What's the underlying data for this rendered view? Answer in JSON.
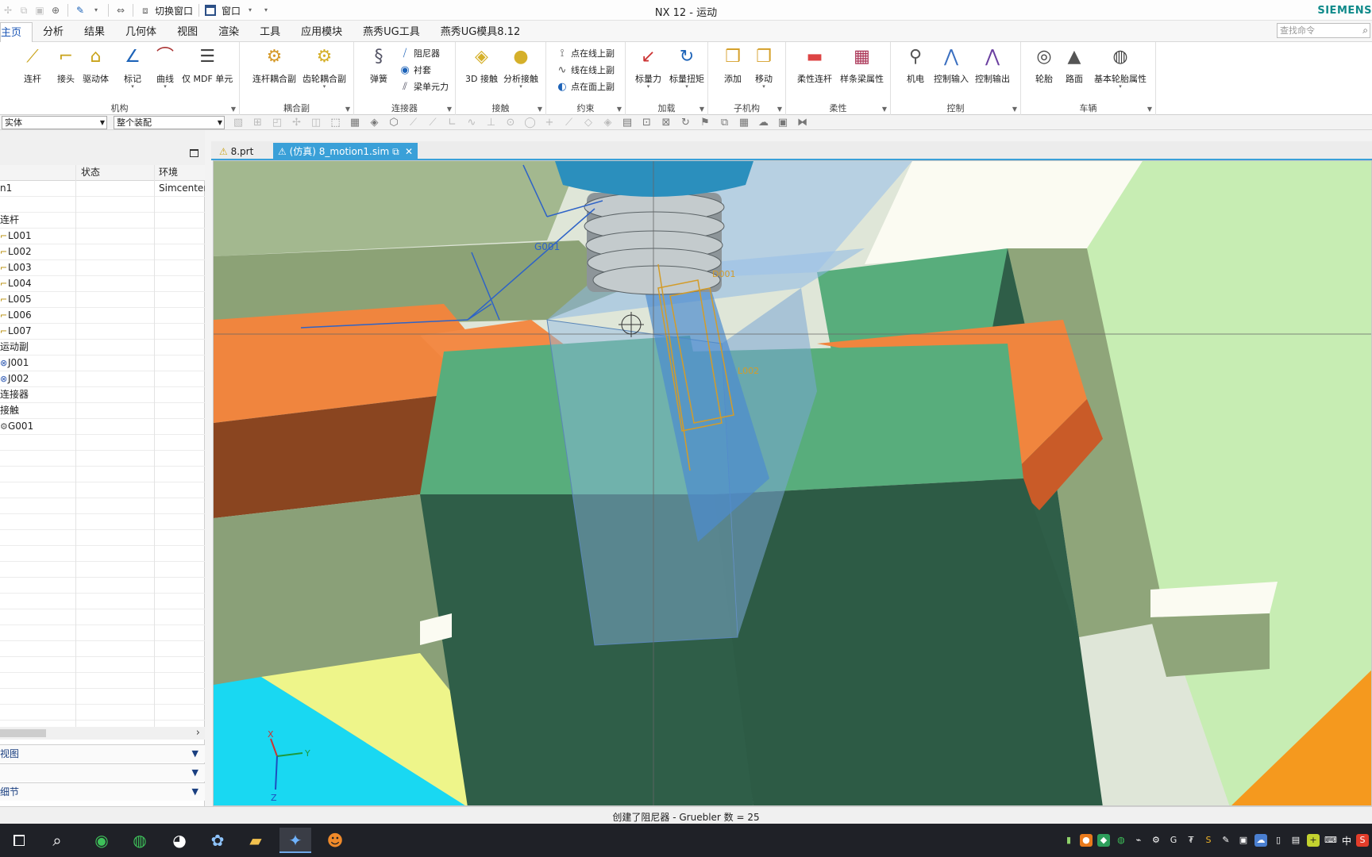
{
  "window": {
    "title": "NX 12 - 运动",
    "brand": "SIEMENS",
    "qat": {
      "switch_window": "切换窗口",
      "window_menu": "窗口"
    }
  },
  "menu": {
    "tabs": [
      {
        "label": "主页",
        "active": true
      },
      {
        "label": "分析"
      },
      {
        "label": "结果"
      },
      {
        "label": "几何体"
      },
      {
        "label": "视图"
      },
      {
        "label": "渲染"
      },
      {
        "label": "工具"
      },
      {
        "label": "应用模块"
      },
      {
        "label": "燕秀UG工具"
      },
      {
        "label": "燕秀UG模具8.12"
      }
    ],
    "search_placeholder": "查找命令"
  },
  "ribbon": {
    "groups": {
      "mechanism": "机构",
      "coupler": "耦合副",
      "connector": "连接器",
      "contact": "接触",
      "constraint": "约束",
      "load": "加载",
      "submechanism": "子机构",
      "flexible": "柔性",
      "control": "控制",
      "vehicle": "车辆"
    },
    "buttons": {
      "link": "连杆",
      "joint": "接头",
      "driver": "驱动体",
      "marker": "标记",
      "curve": "曲线",
      "mdf": "仅 MDF 单元",
      "link_coupler": "连杆耦合副",
      "gear_coupler": "齿轮耦合副",
      "spring": "弹簧",
      "damper": "阻尼器",
      "bushing": "衬套",
      "beam_force": "梁单元力",
      "contact_3d": "3D 接触",
      "analytic_contact": "分析接触",
      "point_on_curve": "点在线上副",
      "curve_on_curve": "线在线上副",
      "point_on_surface": "点在面上副",
      "scalar_force": "标量力",
      "scalar_torque": "标量扭矩",
      "add": "添加",
      "move": "移动",
      "flex_link": "柔性连杆",
      "spline_beam": "样条梁属性",
      "mechatronics": "机电",
      "control_input": "控制输入",
      "control_output": "控制输出",
      "tire": "轮胎",
      "road": "路面",
      "basic_tire": "基本轮胎属性"
    }
  },
  "selection": {
    "filter": "实体",
    "scope": "整个装配"
  },
  "navigator": {
    "columns": [
      "",
      "状态",
      "环境"
    ],
    "rows": [
      {
        "name": "n1",
        "status": "",
        "env": "Simcenter",
        "icon": ""
      },
      {
        "name": "",
        "status": "",
        "env": "",
        "icon": ""
      },
      {
        "name": "连杆",
        "status": "",
        "env": "",
        "icon": ""
      },
      {
        "name": "L001",
        "status": "",
        "env": "",
        "icon": "link"
      },
      {
        "name": "L002",
        "status": "",
        "env": "",
        "icon": "link"
      },
      {
        "name": "L003",
        "status": "",
        "env": "",
        "icon": "link"
      },
      {
        "name": "L004",
        "status": "",
        "env": "",
        "icon": "link"
      },
      {
        "name": "L005",
        "status": "",
        "env": "",
        "icon": "link"
      },
      {
        "name": "L006",
        "status": "",
        "env": "",
        "icon": "link"
      },
      {
        "name": "L007",
        "status": "",
        "env": "",
        "icon": "link"
      },
      {
        "name": "运动副",
        "status": "",
        "env": "",
        "icon": ""
      },
      {
        "name": "J001",
        "status": "",
        "env": "",
        "icon": "joint"
      },
      {
        "name": "J002",
        "status": "",
        "env": "",
        "icon": "joint"
      },
      {
        "name": "连接器",
        "status": "",
        "env": "",
        "icon": ""
      },
      {
        "name": "接触",
        "status": "",
        "env": "",
        "icon": ""
      },
      {
        "name": "G001",
        "status": "",
        "env": "",
        "icon": "gear"
      }
    ],
    "panels": [
      "视图",
      "",
      "细节"
    ]
  },
  "doc_tabs": [
    {
      "label": "8.prt",
      "active": false
    },
    {
      "label": "(仿真) 8_motion1.sim",
      "active": true
    }
  ],
  "viewport": {
    "labels": {
      "g001": "G001",
      "d001": "D001",
      "l002": "L002"
    },
    "triad": {
      "x": "X",
      "y": "Y",
      "z": "Z"
    },
    "colors": {
      "green": "#58ad7c",
      "dark_green": "#2f5e48",
      "sage": "#8fa57a",
      "orange": "#f0853e",
      "brown": "#8a4520",
      "cyan": "#19d8f2",
      "yellow": "#eef58a",
      "light_green": "#c7edb3",
      "glass": "#8db8e6",
      "spring": "#9aa4a8",
      "hub": "#2b8fbd"
    }
  },
  "status": {
    "message": "创建了阻尼器 - Gruebler 数 = 25"
  },
  "taskbar": {
    "apps": [
      "task-view",
      "search",
      "browser",
      "wechat",
      "qq",
      "nx",
      "explorer",
      "nx-active",
      "mask"
    ],
    "ime": "中"
  }
}
